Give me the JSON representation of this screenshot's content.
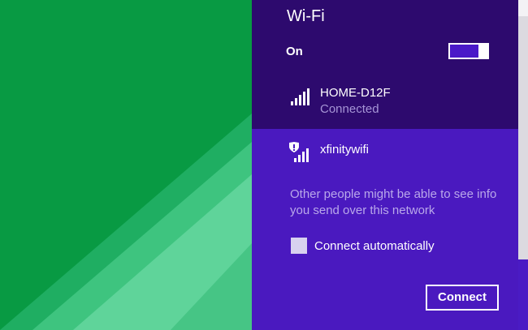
{
  "panel": {
    "title": "Wi-Fi",
    "wifi_toggle_label": "On",
    "wifi_toggle_on": true
  },
  "networks": [
    {
      "name": "HOME-D12F",
      "status": "Connected",
      "icon": "wifi-signal-icon"
    },
    {
      "name": "xfinitywifi",
      "icon": "wifi-signal-unsecured-icon",
      "warning": "Other people might be able to see info you send over this network",
      "connect_automatically_label": "Connect automatically",
      "connect_automatically_checked": false,
      "connect_button_label": "Connect"
    }
  ],
  "colors": {
    "panel_bg": "#2d0a6e",
    "selected_bg": "#4a19bf",
    "wallpaper_green": "#079942"
  }
}
